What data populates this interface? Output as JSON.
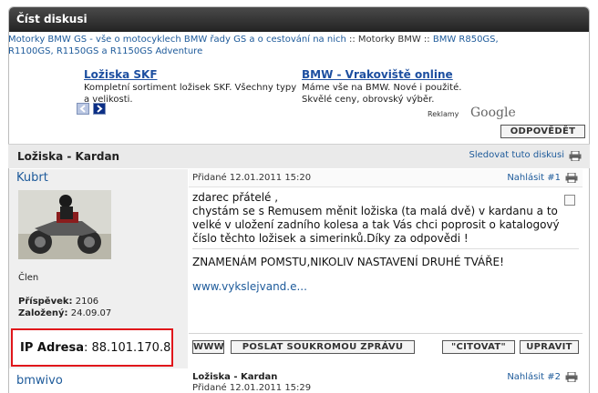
{
  "window": {
    "title": "Číst diskusi"
  },
  "breadcrumb": {
    "link1": "Motorky BMW GS - vše o motocyklech BMW řady GS a o cestování na nich",
    "sep1": " :: ",
    "text2": "Motorky BMW",
    "sep2": " :: ",
    "link3": "BMW R850GS, R1100GS, R1150GS a R1150GS Adventure"
  },
  "ads": {
    "ad1": {
      "title": "Ložiska SKF",
      "text": "Kompletní sortiment ložisek SKF. Všechny typy a velikosti."
    },
    "ad2": {
      "title": "BMW - Vrakoviště online",
      "text": "Máme vše na BMW. Nové i použité. Skvělé ceny, obrovský výběr."
    },
    "label": "Reklamy",
    "brand": "Google"
  },
  "reply_button": "ODPOVĚDĚT",
  "thread": {
    "title": "Ložiska - Kardan",
    "watch_link": "Sledovat tuto diskusi"
  },
  "post1": {
    "author": "Kubrt",
    "rank": "Člen",
    "posts_label": "Příspěvek:",
    "posts_value": "2106",
    "joined_label": "Založený:",
    "joined_value": "24.09.07",
    "ip_label": "IP Adresa",
    "ip_value": "88.101.170.8",
    "date": "Přidané 12.01.2011 15:20",
    "report": "Nahlásit #1",
    "body": "zdarec přátelé ,\nchystám se s Remusem měnit ložiska (ta malá dvě) v kardanu a to velké v uložení zadního kolesa a tak Vás chci poprosit o katalogový číslo těchto ložisek a simerinků.Díky za odpovědi !",
    "shout": "ZNAMENÁM POMSTU,NIKOLIV NASTAVENÍ DRUHÉ TVÁŘE!",
    "signature": "www.vykslejvand.e...",
    "btn_www": "WWW",
    "btn_pm": "POSLAT SOUKROMOU ZPRÁVU",
    "btn_quote": "\"CITOVAT\"",
    "btn_edit": "UPRAVIT"
  },
  "post2": {
    "author": "bmwivo",
    "title": "Ložiska - Kardan",
    "date": "Přidané 12.01.2011 15:29",
    "report": "Nahlásit #2"
  }
}
